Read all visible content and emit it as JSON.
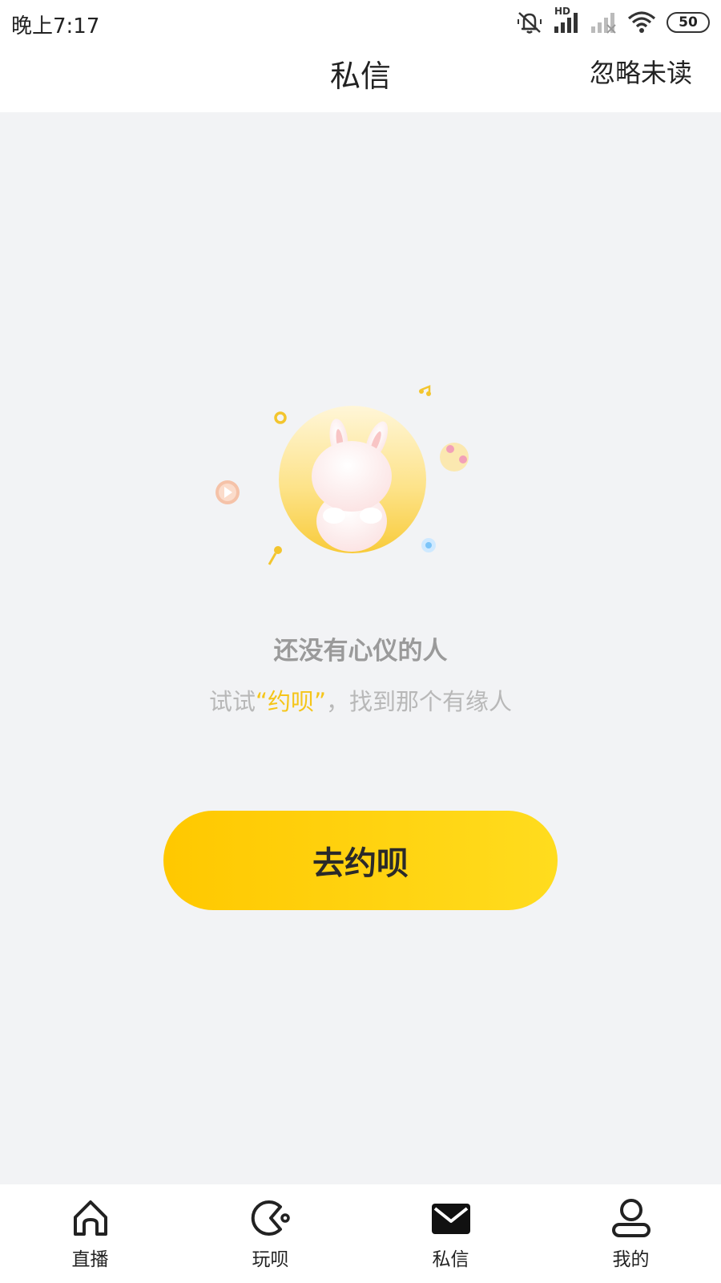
{
  "status_bar": {
    "time": "晚上7:17",
    "network_label": "HD",
    "battery": "50",
    "icons": [
      "silent-icon",
      "signal-icon",
      "signal-empty-icon",
      "wifi-icon",
      "battery-icon"
    ]
  },
  "header": {
    "title": "私信",
    "ignore_unread": "忽略未读"
  },
  "empty_state": {
    "title": "还没有心仪的人",
    "subtitle_prefix": "试试",
    "subtitle_highlight": "“约呗”",
    "subtitle_suffix": "，找到那个有缘人",
    "highlight_color": "#f5c518"
  },
  "cta": {
    "label": "去约呗",
    "color": "#ffd20a"
  },
  "tab_bar": {
    "items": [
      {
        "label": "直播",
        "icon": "home-icon"
      },
      {
        "label": "玩呗",
        "icon": "game-icon"
      },
      {
        "label": "私信",
        "icon": "mail-icon",
        "active": true
      },
      {
        "label": "我的",
        "icon": "profile-icon"
      }
    ]
  }
}
